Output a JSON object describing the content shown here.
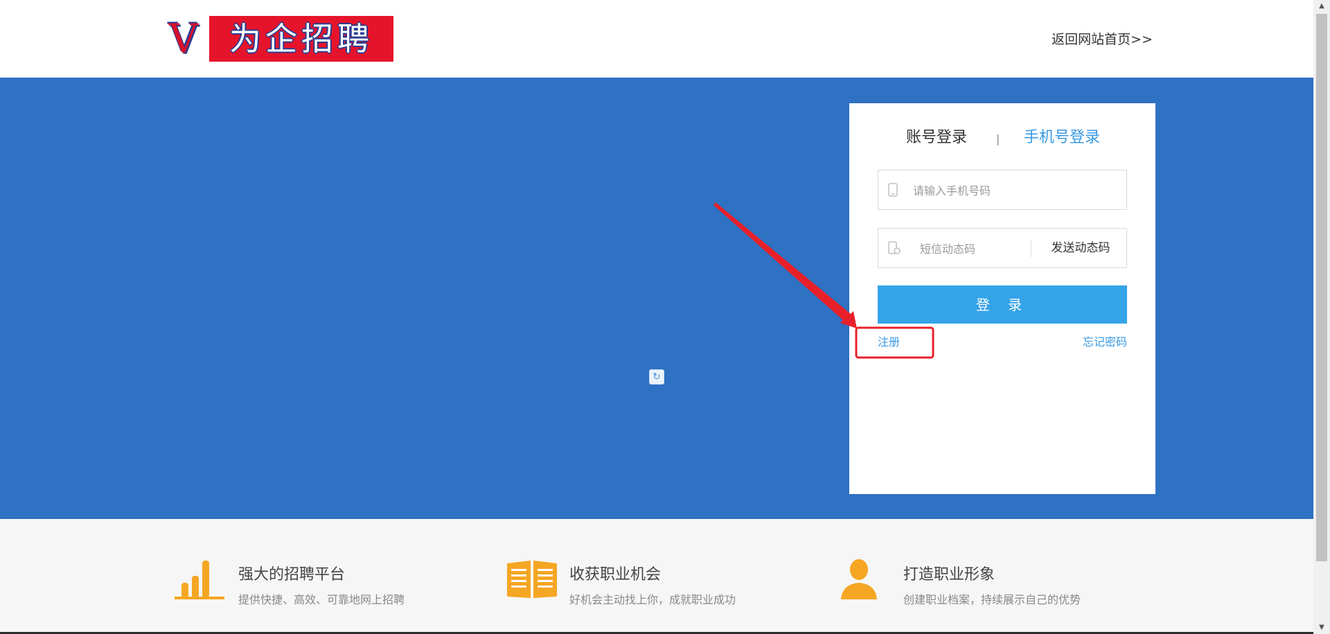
{
  "header": {
    "logo_letter": "V",
    "logo_text": "为企招聘",
    "back_home": "返回网站首页>>"
  },
  "login": {
    "tab_account": "账号登录",
    "tab_separator": "|",
    "tab_phone": "手机号登录",
    "phone_placeholder": "请输入手机号码",
    "code_placeholder": "短信动态码",
    "send_code": "发送动态码",
    "login_button": "登 录",
    "register": "注册",
    "forgot": "忘记密码"
  },
  "features": [
    {
      "title": "强大的招聘平台",
      "desc": "提供快捷、高效、可靠地网上招聘",
      "icon": "bar-chart-icon"
    },
    {
      "title": "收获职业机会",
      "desc": "好机会主动找上你，成就职业成功",
      "icon": "open-book-icon"
    },
    {
      "title": "打造职业形象",
      "desc": "创建职业档案，持续展示自己的优势",
      "icon": "person-icon"
    }
  ],
  "colors": {
    "banner": "#2f71c3",
    "accent": "#35a3e8",
    "link": "#3a9ae3",
    "feature_icon": "#f5a623",
    "annotation": "#e8202a"
  }
}
